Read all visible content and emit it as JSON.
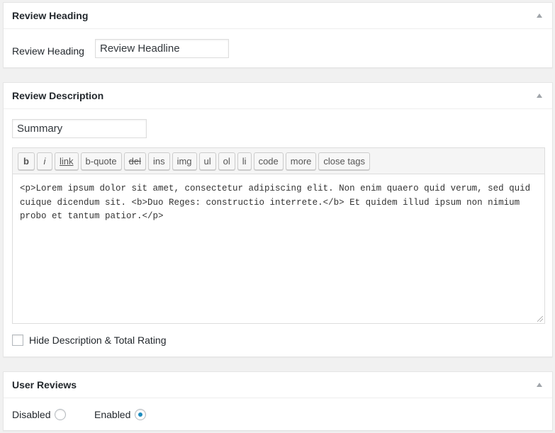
{
  "review_heading_box": {
    "title": "Review Heading",
    "field_label": "Review Heading",
    "field_value": "Review Headline"
  },
  "review_description_box": {
    "title": "Review Description",
    "summary_value": "Summary",
    "toolbar": {
      "bold": "b",
      "italic": "i",
      "link": "link",
      "blockquote": "b-quote",
      "del": "del",
      "ins": "ins",
      "img": "img",
      "ul": "ul",
      "ol": "ol",
      "li": "li",
      "code": "code",
      "more": "more",
      "close_tags": "close tags"
    },
    "editor_content": "<p>Lorem ipsum dolor sit amet, consectetur adipiscing elit. Non enim quaero quid verum, sed quid cuique dicendum sit. <b>Duo Reges: constructio interrete.</b> Et quidem illud ipsum non nimium probo et tantum patior.</p>",
    "hide_checkbox_label": "Hide Description & Total Rating",
    "hide_checked": false
  },
  "user_reviews_box": {
    "title": "User Reviews",
    "disabled_label": "Disabled",
    "enabled_label": "Enabled",
    "selected": "Enabled"
  },
  "colors": {
    "accent": "#1e8cbe",
    "background": "#f1f1f1",
    "panel": "#ffffff"
  }
}
